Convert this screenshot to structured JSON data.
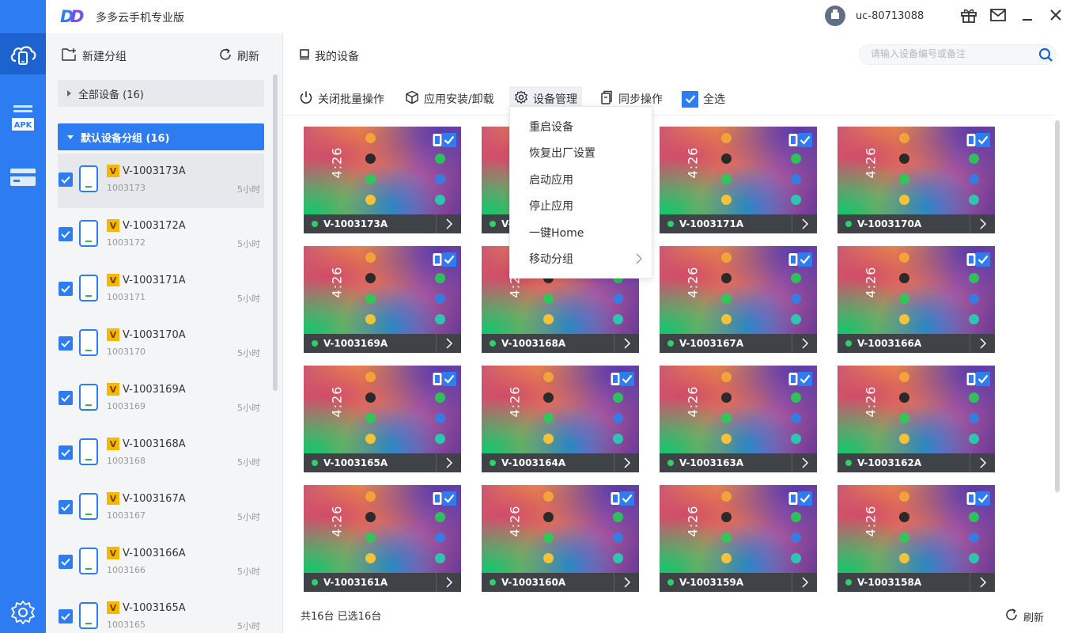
{
  "app": {
    "title": "多多云手机专业版",
    "logo_text": "DD",
    "user": "uc-80713088",
    "accent": "#2d7cf2"
  },
  "rail": {
    "items": [
      {
        "icon": "cloud-phone-icon",
        "active": true
      },
      {
        "icon": "apk-icon",
        "label": "APK"
      },
      {
        "icon": "card-icon"
      },
      {
        "icon": "settings-gear-icon"
      }
    ]
  },
  "sidebar": {
    "new_group": "新建分组",
    "refresh": "刷新",
    "all_devices": "全部设备 (16)",
    "default_group": "默认设备分组 (16)",
    "devices": [
      {
        "name": "V-1003173A",
        "id": "1003173",
        "time": "5小时",
        "badge": "V"
      },
      {
        "name": "V-1003172A",
        "id": "1003172",
        "time": "5小时",
        "badge": "V"
      },
      {
        "name": "V-1003171A",
        "id": "1003171",
        "time": "5小时",
        "badge": "V"
      },
      {
        "name": "V-1003170A",
        "id": "1003170",
        "time": "5小时",
        "badge": "V"
      },
      {
        "name": "V-1003169A",
        "id": "1003169",
        "time": "5小时",
        "badge": "V"
      },
      {
        "name": "V-1003168A",
        "id": "1003168",
        "time": "5小时",
        "badge": "V"
      },
      {
        "name": "V-1003167A",
        "id": "1003167",
        "time": "5小时",
        "badge": "V"
      },
      {
        "name": "V-1003166A",
        "id": "1003166",
        "time": "5小时",
        "badge": "V"
      },
      {
        "name": "V-1003165A",
        "id": "1003165",
        "time": "5小时",
        "badge": "V"
      }
    ]
  },
  "main": {
    "title": "我的设备",
    "search_placeholder": "请输入设备编号或备注",
    "toolbar": {
      "close_batch": "关闭批量操作",
      "app_install": "应用安装/卸载",
      "device_manage": "设备管理",
      "sync": "同步操作",
      "select_all": "全选"
    },
    "menu": {
      "items": [
        "重启设备",
        "恢复出厂设置",
        "启动应用",
        "停止应用",
        "一键Home",
        "移动分组"
      ]
    },
    "screen_time": "4:26",
    "cards": [
      "V-1003173A",
      "V-1003172A",
      "V-1003171A",
      "V-1003170A",
      "V-1003169A",
      "V-1003168A",
      "V-1003167A",
      "V-1003166A",
      "V-1003165A",
      "V-1003164A",
      "V-1003163A",
      "V-1003162A",
      "V-1003161A",
      "V-1003160A",
      "V-1003159A",
      "V-1003158A"
    ],
    "footer": {
      "count": "共16台  已选16台",
      "refresh": "刷新"
    }
  }
}
